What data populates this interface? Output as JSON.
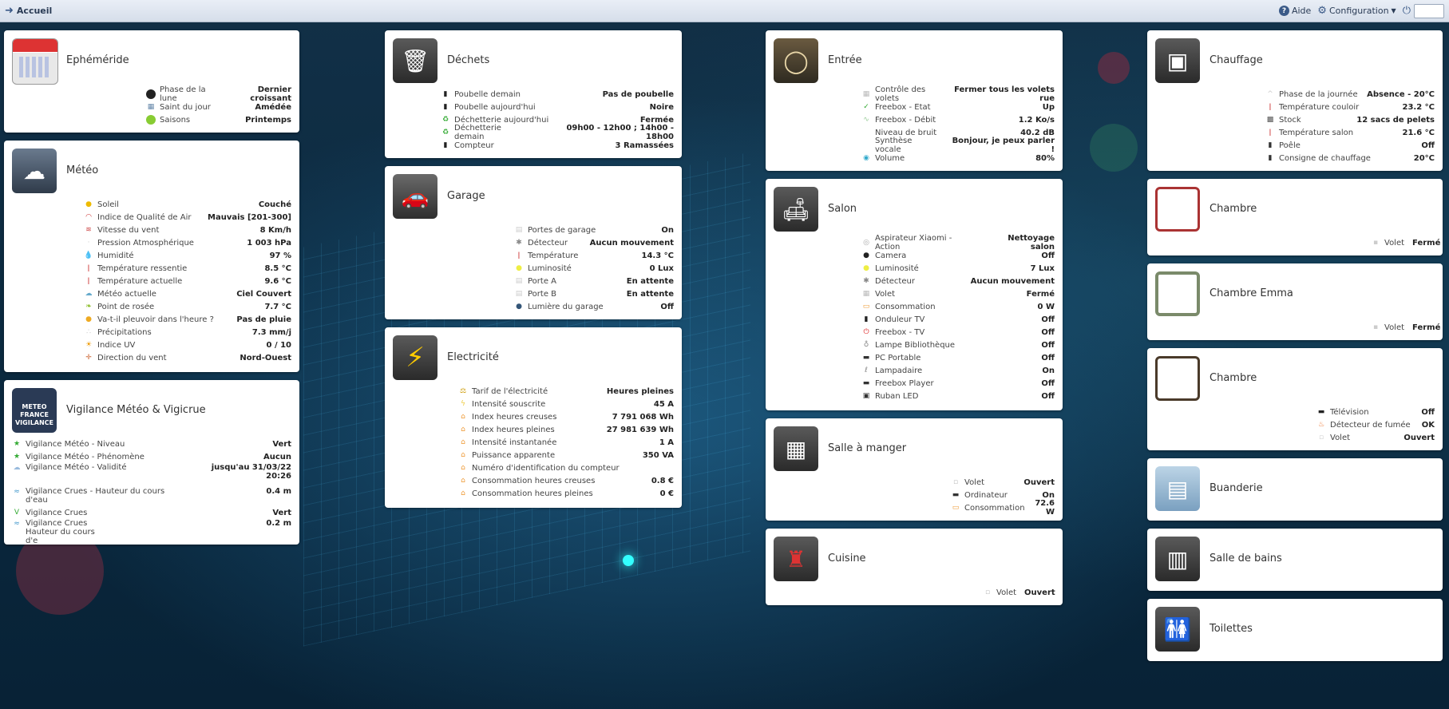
{
  "nav": {
    "home": "Accueil",
    "help": "Aide",
    "config": "Configuration"
  },
  "cards": {
    "ephemeride": {
      "title": "Ephéméride",
      "rows": [
        {
          "label": "Phase de la lune",
          "value": "Dernier croissant"
        },
        {
          "label": "Saint du jour",
          "value": "Amédée"
        },
        {
          "label": "Saisons",
          "value": "Printemps"
        }
      ]
    },
    "meteo": {
      "title": "Météo",
      "rows": [
        {
          "label": "Soleil",
          "value": "Couché"
        },
        {
          "label": "Indice de Qualité de Air",
          "value": "Mauvais [201-300]"
        },
        {
          "label": "Vitesse du vent",
          "value": "8 Km/h"
        },
        {
          "label": "Pression Atmosphérique",
          "value": "1 003 hPa"
        },
        {
          "label": "Humidité",
          "value": "97 %"
        },
        {
          "label": "Température ressentie",
          "value": "8.5 °C"
        },
        {
          "label": "Température actuelle",
          "value": "9.6 °C"
        },
        {
          "label": "Météo actuelle",
          "value": "Ciel Couvert"
        },
        {
          "label": "Point de rosée",
          "value": "7.7 °C"
        },
        {
          "label": "Va-t-il pleuvoir dans l'heure ?",
          "value": "Pas de pluie"
        },
        {
          "label": "Précipitations",
          "value": "7.3 mm/j"
        },
        {
          "label": "Indice UV",
          "value": "0 / 10"
        },
        {
          "label": "Direction du vent",
          "value": "Nord-Ouest"
        }
      ]
    },
    "vigilance": {
      "title": "Vigilance Météo & Vigicrue",
      "logo": [
        "METEO",
        "FRANCE",
        "VIGILANCE"
      ],
      "rows": [
        {
          "label": "Vigilance Météo - Niveau",
          "value": "Vert"
        },
        {
          "label": "Vigilance Météo - Phénomène",
          "value": "Aucun"
        },
        {
          "label": "Vigilance Météo - Validité",
          "value": "jusqu'au 31/03/22 20:26"
        },
        {
          "label": "Vigilance Crues - Hauteur du cours d'eau",
          "value": "0.4 m"
        },
        {
          "label": "Vigilance Crues",
          "value": "Vert"
        },
        {
          "label": "Vigilance Crues Hauteur du cours d'e",
          "value": "0.2 m"
        }
      ]
    },
    "dechets": {
      "title": "Déchets",
      "rows": [
        {
          "label": "Poubelle demain",
          "value": "Pas de poubelle"
        },
        {
          "label": "Poubelle aujourd'hui",
          "value": "Noire"
        },
        {
          "label": "Déchetterie aujourd'hui",
          "value": "Fermée"
        },
        {
          "label": "Déchetterie demain",
          "value": "09h00 - 12h00 ; 14h00 - 18h00"
        },
        {
          "label": "Compteur",
          "value": "3 Ramassées"
        }
      ]
    },
    "garage": {
      "title": "Garage",
      "rows": [
        {
          "label": "Portes de garage",
          "value": "On"
        },
        {
          "label": "Détecteur",
          "value": "Aucun mouvement"
        },
        {
          "label": "Température",
          "value": "14.3 °C"
        },
        {
          "label": "Luminosité",
          "value": "0 Lux"
        },
        {
          "label": "Porte A",
          "value": "En attente"
        },
        {
          "label": "Porte B",
          "value": "En attente"
        },
        {
          "label": "Lumière du garage",
          "value": "Off"
        }
      ]
    },
    "electricite": {
      "title": "Electricité",
      "rows": [
        {
          "label": "Tarif de l'électricité",
          "value": "Heures pleines"
        },
        {
          "label": "Intensité souscrite",
          "value": "45 A"
        },
        {
          "label": "Index heures creuses",
          "value": "7 791 068 Wh"
        },
        {
          "label": "Index heures pleines",
          "value": "27 981 639 Wh"
        },
        {
          "label": "Intensité instantanée",
          "value": "1 A"
        },
        {
          "label": "Puissance apparente",
          "value": "350 VA"
        },
        {
          "label": "Numéro d'identification du compteur",
          "value": ""
        },
        {
          "label": "Consommation heures creuses",
          "value": "0.8 €"
        },
        {
          "label": "Consommation heures pleines",
          "value": "0 €"
        }
      ]
    },
    "entree": {
      "title": "Entrée",
      "rows": [
        {
          "label": "Contrôle des volets",
          "value": "Fermer tous les volets rue"
        },
        {
          "label": "Freebox - Etat",
          "value": "Up"
        },
        {
          "label": "Freebox - Débit",
          "value": "1.2 Ko/s"
        },
        {
          "label": "Niveau de bruit",
          "value": "40.2 dB"
        },
        {
          "label": "Synthèse vocale",
          "value": "Bonjour, je peux parler !"
        },
        {
          "label": "Volume",
          "value": "80%"
        }
      ]
    },
    "salon": {
      "title": "Salon",
      "rows": [
        {
          "label": "Aspirateur Xiaomi - Action",
          "value": "Nettoyage salon"
        },
        {
          "label": "Camera",
          "value": "Off"
        },
        {
          "label": "Luminosité",
          "value": "7 Lux"
        },
        {
          "label": "Détecteur",
          "value": "Aucun mouvement"
        },
        {
          "label": "Volet",
          "value": "Fermé"
        },
        {
          "label": "Consommation",
          "value": "0 W"
        },
        {
          "label": "Onduleur TV",
          "value": "Off"
        },
        {
          "label": "Freebox - TV",
          "value": "Off"
        },
        {
          "label": "Lampe Bibliothèque",
          "value": "Off"
        },
        {
          "label": "PC Portable",
          "value": "Off"
        },
        {
          "label": "Lampadaire",
          "value": "On"
        },
        {
          "label": "Freebox Player",
          "value": "Off"
        },
        {
          "label": "Ruban LED",
          "value": "Off"
        }
      ]
    },
    "salle_manger": {
      "title": "Salle à manger",
      "rows": [
        {
          "label": "Volet",
          "value": "Ouvert"
        },
        {
          "label": "Ordinateur",
          "value": "On"
        },
        {
          "label": "Consommation",
          "value": "72.6 W"
        }
      ]
    },
    "cuisine": {
      "title": "Cuisine",
      "rows": [
        {
          "label": "Volet",
          "value": "Ouvert"
        }
      ]
    },
    "chauffage": {
      "title": "Chauffage",
      "rows": [
        {
          "label": "Phase de la journée",
          "value": "Absence - 20°C"
        },
        {
          "label": "Température couloir",
          "value": "23.2 °C"
        },
        {
          "label": "Stock",
          "value": "12 sacs de pelets"
        },
        {
          "label": "Température salon",
          "value": "21.6 °C"
        },
        {
          "label": "Poêle",
          "value": "Off"
        },
        {
          "label": "Consigne de chauffage",
          "value": "20°C"
        }
      ]
    },
    "chambre1": {
      "title": "Chambre ",
      "rows": [
        {
          "label": "Volet",
          "value": "Fermé"
        }
      ]
    },
    "chambre2": {
      "title": "Chambre Emma",
      "rows": [
        {
          "label": "Volet",
          "value": "Fermé"
        }
      ]
    },
    "chambre3": {
      "title": "Chambre",
      "rows": [
        {
          "label": "Télévision",
          "value": "Off"
        },
        {
          "label": "Détecteur de fumée",
          "value": "OK"
        },
        {
          "label": "Volet",
          "value": "Ouvert"
        }
      ]
    },
    "buanderie": {
      "title": "Buanderie",
      "rows": []
    },
    "salle_bains": {
      "title": "Salle de bains",
      "rows": []
    },
    "toilettes": {
      "title": "Toilettes",
      "rows": []
    }
  }
}
